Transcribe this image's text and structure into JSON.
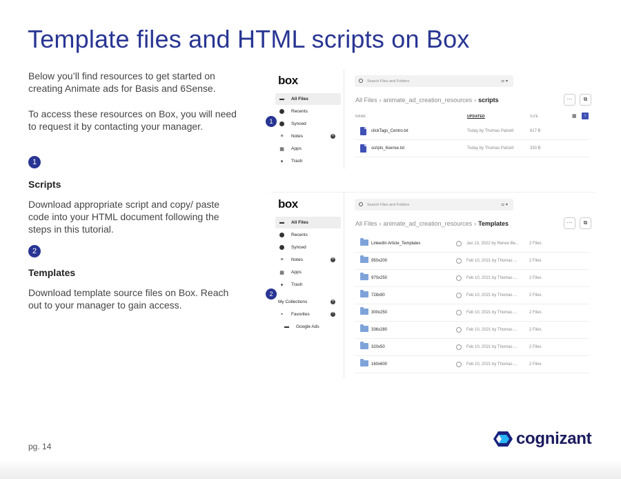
{
  "title": "Template files and HTML scripts on Box",
  "intro_1": "Below you’ll find resources to get started on creating Animate ads for Basis and 6Sense.",
  "intro_2": "To access these resources on Box, you will need to  request it by contacting your manager.",
  "steps": [
    {
      "number": "1",
      "heading": "Scripts",
      "body": "Download appropriate script and copy/ paste code into your HTML document following the steps in this tutorial."
    },
    {
      "number": "2",
      "heading": "Templates",
      "body": "Download template source files on Box. Reach out to your manager to gain access."
    }
  ],
  "page_number": "pg. 14",
  "brand": "cognizant",
  "colors": {
    "accent": "#283593",
    "box_file_blue": "#3f51b5",
    "folder_blue": "#7ea3d9"
  },
  "box_scripts": {
    "logo": "box",
    "search_placeholder": "Search Files and Folders",
    "nav": [
      {
        "label": "All Files",
        "icon": "folder-icon"
      },
      {
        "label": "Recents",
        "icon": "clock-icon"
      },
      {
        "label": "Synced",
        "icon": "check-circle-icon"
      },
      {
        "label": "Notes",
        "icon": "notes-icon"
      },
      {
        "label": "Apps",
        "icon": "apps-grid-icon"
      },
      {
        "label": "Trash",
        "icon": "trash-icon"
      }
    ],
    "breadcrumb": [
      "All Files",
      "animate_ad_creation_resources",
      "scripts"
    ],
    "more_label": "···",
    "columns": {
      "name": "NAME",
      "updated": "UPDATED",
      "size": "SIZE"
    },
    "files": [
      {
        "name": "clickTags_Centro.txt",
        "updated": "Today by Thomas Patzelt",
        "size": "617 B"
      },
      {
        "name": "scripts_6sense.txt",
        "updated": "Today by Thomas Patzelt",
        "size": "333 B"
      }
    ]
  },
  "box_templates": {
    "logo": "box",
    "search_placeholder": "Search Files and Folders",
    "nav": [
      {
        "label": "All Files",
        "icon": "folder-icon"
      },
      {
        "label": "Recents",
        "icon": "clock-icon"
      },
      {
        "label": "Synced",
        "icon": "check-circle-icon"
      },
      {
        "label": "Notes",
        "icon": "notes-icon"
      },
      {
        "label": "Apps",
        "icon": "apps-grid-icon"
      },
      {
        "label": "Trash",
        "icon": "trash-icon"
      },
      {
        "label": "My Collections",
        "icon": ""
      },
      {
        "label": "Favorites",
        "icon": "favorites-icon"
      },
      {
        "label": "Google Ads",
        "icon": "collection-folder-icon"
      }
    ],
    "breadcrumb": [
      "All Files",
      "animate_ad_creation_resources",
      "Templates"
    ],
    "more_label": "···",
    "folders": [
      {
        "name": "LinkedIn Article_Templates",
        "updated": "Jan 13, 2022 by Renee Be...",
        "size": "2 Files"
      },
      {
        "name": "950x200",
        "updated": "Feb 10, 2021 by Thomas ...",
        "size": "2 Files"
      },
      {
        "name": "970x250",
        "updated": "Feb 10, 2021 by Thomas ...",
        "size": "2 Files"
      },
      {
        "name": "728x90",
        "updated": "Feb 10, 2021 by Thomas ...",
        "size": "2 Files"
      },
      {
        "name": "300x250",
        "updated": "Feb 10, 2021 by Thomas ...",
        "size": "2 Files"
      },
      {
        "name": "336x280",
        "updated": "Feb 10, 2021 by Thomas ...",
        "size": "2 Files"
      },
      {
        "name": "320x50",
        "updated": "Feb 10, 2021 by Thomas ...",
        "size": "2 Files"
      },
      {
        "name": "160x600",
        "updated": "Feb 10, 2021 by Thomas ...",
        "size": "2 Files"
      }
    ]
  }
}
